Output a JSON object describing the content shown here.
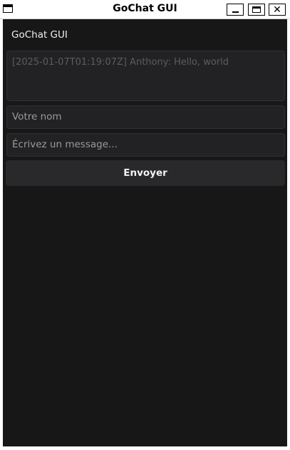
{
  "window": {
    "title": "GoChat GUI",
    "icons": {
      "app": "window-icon",
      "minimize": "minimize-icon",
      "maximize": "maximize-icon",
      "close": "close-icon"
    },
    "close_glyph": "✕"
  },
  "app": {
    "heading": "GoChat GUI",
    "log_text": "[2025-01-07T01:19:07Z] Anthony: Hello, world",
    "name_placeholder": "Votre nom",
    "message_placeholder": "Écrivez un message...",
    "send_label": "Envoyer"
  },
  "colors": {
    "background": "#171717",
    "field": "#222224",
    "button": "#29292c",
    "text": "#f0f0f0",
    "placeholder": "#9a9a9a"
  }
}
